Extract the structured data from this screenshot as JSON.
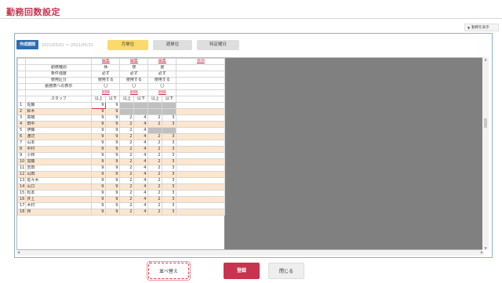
{
  "page": {
    "title": "勤務回数設定"
  },
  "toggle": {
    "label": "勤務を表示"
  },
  "toolbar": {
    "period_label": "作成期間",
    "period_value": "2021/05/01 〜 2021/05/31",
    "unit_monthly": "月単位",
    "unit_weekly": "週単位",
    "unit_specific": "特定曜日"
  },
  "grid": {
    "row_labels": {
      "shift_type": "勤務種別",
      "condition": "条件強度",
      "usage": "使用区分",
      "display": "勤務表への表示",
      "staff": "スタッフ"
    },
    "edit_link": "編集",
    "add_link": "追加",
    "delete_link": "削除",
    "shifts": [
      {
        "type": "休",
        "condition": "必ず",
        "usage": "使用する",
        "display": "〇"
      },
      {
        "type": "夜",
        "condition": "必ず",
        "usage": "使用する",
        "display": "〇"
      },
      {
        "type": "遅",
        "condition": "必ず",
        "usage": "使用する",
        "display": "〇"
      }
    ],
    "min_label": "以上",
    "max_label": "以下",
    "staff": [
      {
        "no": "1",
        "name": "佐藤",
        "vals": [
          "9",
          "9",
          "",
          "",
          "",
          ""
        ]
      },
      {
        "no": "2",
        "name": "鈴木",
        "vals": [
          "9",
          "9",
          "",
          "",
          "",
          ""
        ]
      },
      {
        "no": "3",
        "name": "高橋",
        "vals": [
          "9",
          "9",
          "2",
          "4",
          "2",
          "3"
        ]
      },
      {
        "no": "4",
        "name": "田中",
        "vals": [
          "9",
          "9",
          "2",
          "4",
          "2",
          "3"
        ]
      },
      {
        "no": "5",
        "name": "伊藤",
        "vals": [
          "9",
          "9",
          "2",
          "4",
          "",
          ""
        ]
      },
      {
        "no": "6",
        "name": "渡辺",
        "vals": [
          "9",
          "9",
          "2",
          "4",
          "2",
          "3"
        ]
      },
      {
        "no": "7",
        "name": "山本",
        "vals": [
          "9",
          "9",
          "2",
          "4",
          "2",
          "3"
        ]
      },
      {
        "no": "8",
        "name": "中村",
        "vals": [
          "9",
          "9",
          "2",
          "4",
          "2",
          "3"
        ]
      },
      {
        "no": "9",
        "name": "小林",
        "vals": [
          "9",
          "9",
          "2",
          "4",
          "2",
          "3"
        ]
      },
      {
        "no": "10",
        "name": "加藤",
        "vals": [
          "9",
          "9",
          "2",
          "4",
          "2",
          "3"
        ]
      },
      {
        "no": "11",
        "name": "吉田",
        "vals": [
          "9",
          "9",
          "2",
          "4",
          "2",
          "3"
        ]
      },
      {
        "no": "12",
        "name": "山田",
        "vals": [
          "9",
          "9",
          "2",
          "4",
          "2",
          "3"
        ]
      },
      {
        "no": "13",
        "name": "佐々木",
        "vals": [
          "9",
          "9",
          "2",
          "4",
          "2",
          "3"
        ]
      },
      {
        "no": "14",
        "name": "山口",
        "vals": [
          "9",
          "9",
          "2",
          "4",
          "2",
          "3"
        ]
      },
      {
        "no": "15",
        "name": "松本",
        "vals": [
          "9",
          "9",
          "2",
          "4",
          "2",
          "3"
        ]
      },
      {
        "no": "16",
        "name": "井上",
        "vals": [
          "9",
          "9",
          "2",
          "4",
          "2",
          "3"
        ]
      },
      {
        "no": "17",
        "name": "木村",
        "vals": [
          "9",
          "9",
          "2",
          "4",
          "2",
          "3"
        ]
      },
      {
        "no": "18",
        "name": "林",
        "vals": [
          "9",
          "9",
          "2",
          "4",
          "2",
          "3"
        ]
      }
    ]
  },
  "footer": {
    "reorder": "並べ替え",
    "register": "登録",
    "close": "閉じる"
  },
  "colors": {
    "accent": "#c8334f",
    "primary": "#2f6cb0",
    "monthly_active": "#fbd96a",
    "row_tint": "#fde6cf"
  }
}
